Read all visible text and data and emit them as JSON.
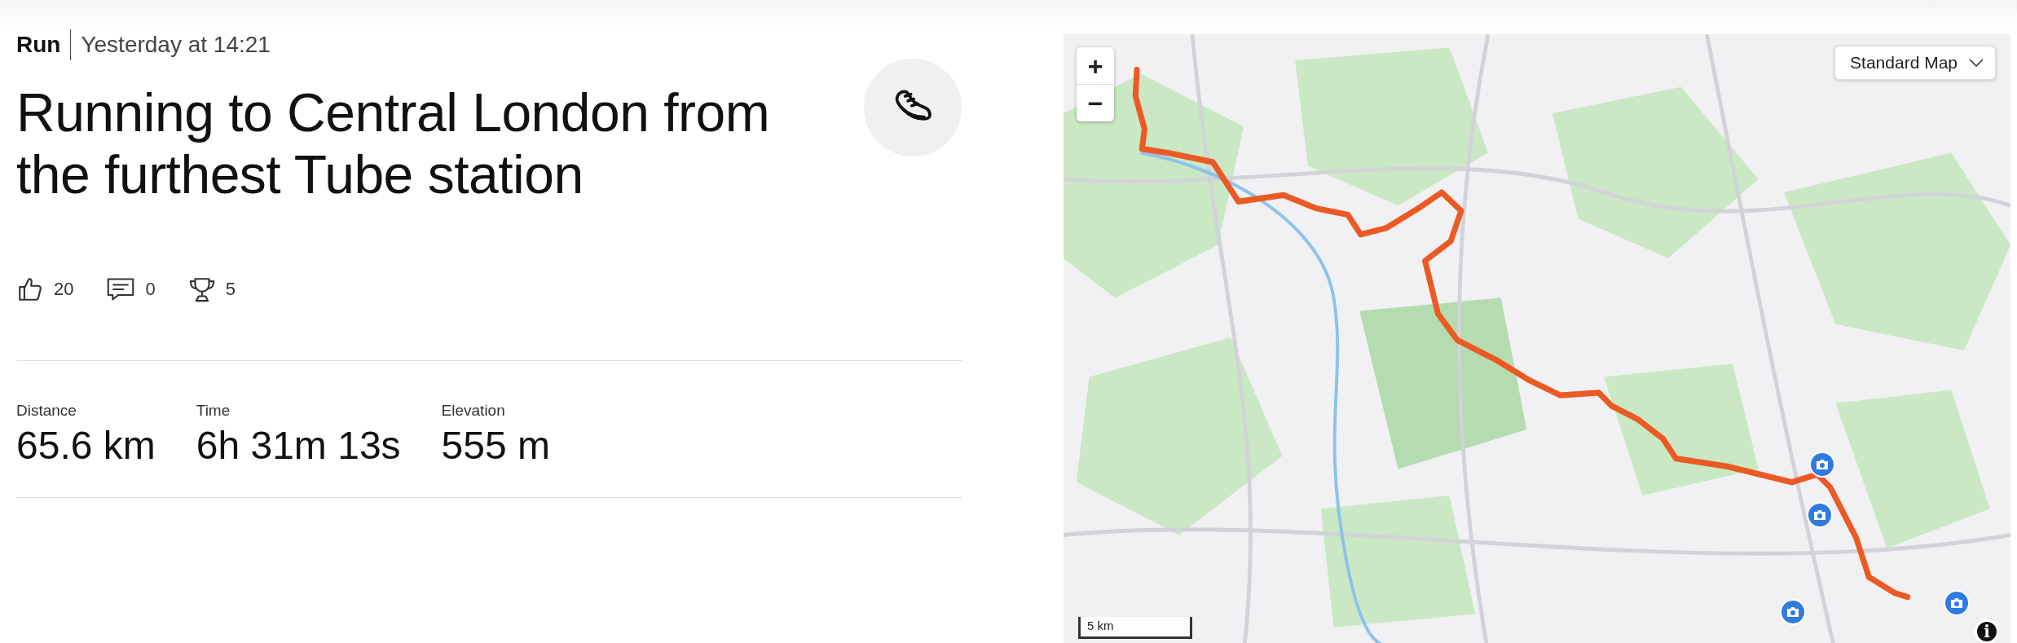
{
  "activity": {
    "sport": "Run",
    "when": "Yesterday at 14:21",
    "title": "Running to Central London from the furthest Tube station",
    "kind": "run"
  },
  "reactions": [
    {
      "kind": "kudos",
      "count": "20"
    },
    {
      "kind": "comments",
      "count": "0"
    },
    {
      "kind": "achievements",
      "count": "5"
    }
  ],
  "stats": [
    {
      "label": "Distance",
      "value": "65.6 km"
    },
    {
      "label": "Time",
      "value": "6h 31m 13s"
    },
    {
      "label": "Elevation",
      "value": "555 m"
    }
  ],
  "map": {
    "zoom_in": "+",
    "zoom_out": "−",
    "style_selector": "Standard Map",
    "scale": "5 km",
    "info": "i"
  }
}
